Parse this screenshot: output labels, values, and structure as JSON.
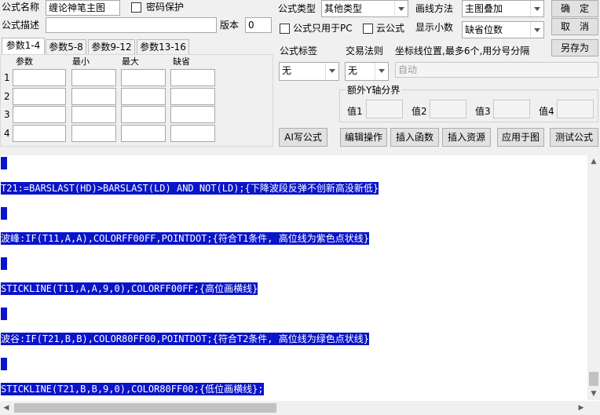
{
  "form": {
    "name_label": "公式名称",
    "name_value": "缠论神笔主图",
    "password_label": "密码保护",
    "desc_label": "公式描述",
    "desc_value": "",
    "version_label": "版本",
    "version_value": "0",
    "type_label": "公式类型",
    "type_value": "其他类型",
    "draw_label": "画线方法",
    "draw_value": "主图叠加",
    "pc_only_label": "公式只用于PC",
    "cloud_label": "云公式",
    "decimals_label": "显示小数",
    "decimals_value": "缺省位数",
    "tag_label": "公式标签",
    "tag_value": "无",
    "trade_label": "交易法则",
    "trade_value": "无",
    "coord_label": "坐标线位置,最多6个,用分号分隔",
    "coord_value": "自动",
    "yaxis_label": "额外Y轴分界",
    "val1_label": "值1",
    "val2_label": "值2",
    "val3_label": "值3",
    "val4_label": "值4"
  },
  "buttons": {
    "ok": "确　定",
    "cancel": "取　消",
    "save_as": "另存为",
    "ai": "AI写公式",
    "edit": "编辑操作",
    "insert_func": "插入函数",
    "insert_res": "插入资源",
    "apply": "应用于图",
    "test": "测试公式"
  },
  "params": {
    "tabs": [
      "参数1-4",
      "参数5-8",
      "参数9-12",
      "参数13-16"
    ],
    "headers": [
      "参数",
      "最小",
      "最大",
      "缺省"
    ],
    "rows": [
      "1",
      "2",
      "3",
      "4"
    ]
  },
  "editor": {
    "lines": [
      "T21:=BARSLAST(HD)>BARSLAST(LD) AND NOT(LD);{下降波段反弹不创新高没新低}",
      "波峰:IF(T11,A,A),COLORFF00FF,POINTDOT;{符合T1条件, 高位线为紫色点状线}",
      "STICKLINE(T11,A,A,9,0),COLORFF00FF;{高位画横线}",
      "波谷:IF(T21,B,B),COLOR80FF00,POINTDOT;{符合T2条件, 高位线为绿色点状线}",
      "STICKLINE(T21,B,B,9,0),COLOR80FF00;{低位画横线};"
    ]
  },
  "colors": {
    "selection": "#0a14c8"
  }
}
